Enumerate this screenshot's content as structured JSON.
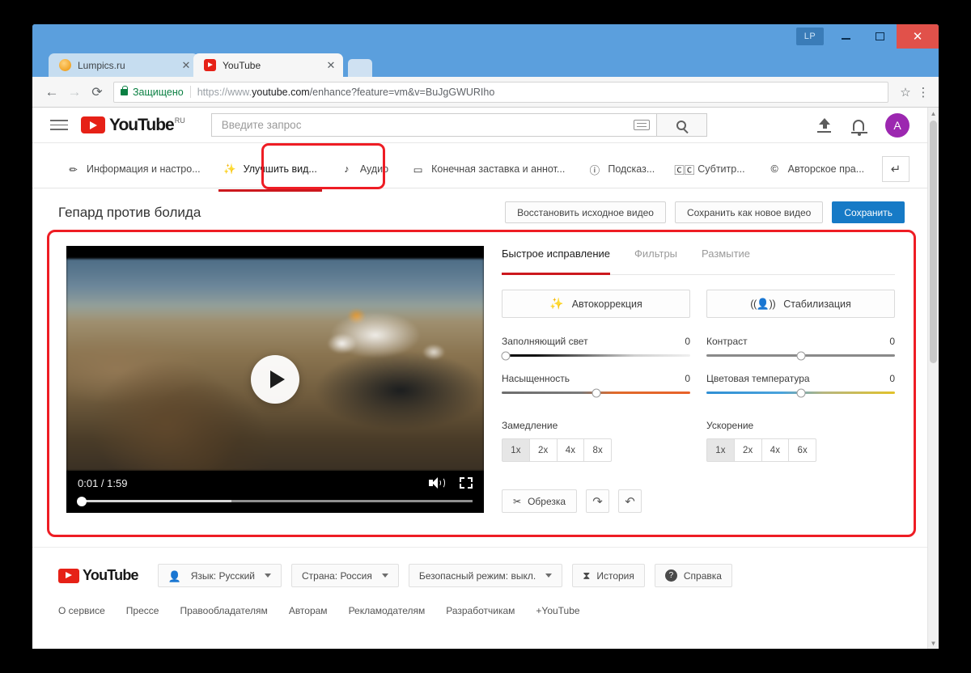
{
  "window": {
    "lp_badge": "LP",
    "minimize": "–",
    "maximize": "□",
    "close": "✕"
  },
  "browser": {
    "tabs": [
      {
        "title": "Lumpics.ru",
        "favicon": "lumpics-favicon",
        "active": false,
        "close": "✕"
      },
      {
        "title": "YouTube",
        "favicon": "youtube-favicon",
        "active": true,
        "close": "✕"
      }
    ],
    "new_tab": "+",
    "back": "←",
    "forward": "→",
    "reload": "⟳",
    "secure_label": "Защищено",
    "url_scheme": "https://www.",
    "url_host": "youtube.com",
    "url_path": "/enhance?feature=vm&v=BuJgGWURIho",
    "bookmark": "☆",
    "menu": "⋮"
  },
  "yt_header": {
    "menu_label": "Меню",
    "logo_text": "YouTube",
    "logo_sup": "RU",
    "search_placeholder": "Введите запрос",
    "search_value": "",
    "keyboard_icon": "keyboard-icon",
    "search_button": "search-icon",
    "upload_icon": "upload-icon",
    "notifications_icon": "bell-icon",
    "avatar_letter": "A"
  },
  "editor_nav": {
    "items": [
      {
        "label": "Информация и настро...",
        "icon": "pencil-icon",
        "active": false
      },
      {
        "label": "Улучшить вид...",
        "icon": "magic-wand-icon",
        "active": true
      },
      {
        "label": "Аудио",
        "icon": "music-note-icon",
        "active": false
      },
      {
        "label": "Конечная заставка и аннот...",
        "icon": "endscreen-icon",
        "active": false
      },
      {
        "label": "Подсказ...",
        "icon": "info-icon",
        "active": false
      },
      {
        "label": "Субтитр...",
        "icon": "cc-icon",
        "active": false
      },
      {
        "label": "Авторское пра...",
        "icon": "copyright-icon",
        "active": false
      }
    ],
    "back_button": "↵"
  },
  "title_row": {
    "video_title": "Гепард против болида",
    "restore_button": "Восстановить исходное видео",
    "save_as_new_button": "Сохранить как новое видео",
    "save_button": "Сохранить"
  },
  "player": {
    "play_button": "play-icon",
    "current_time": "0:01",
    "separator": "/",
    "duration": "1:59",
    "time_display": "0:01 / 1:59",
    "volume_icon": "volume-icon",
    "fullscreen_icon": "fullscreen-icon",
    "played_percent": 1,
    "buffered_percent": 39
  },
  "controls": {
    "tabs": [
      {
        "label": "Быстрое исправление",
        "active": true
      },
      {
        "label": "Фильтры",
        "active": false
      },
      {
        "label": "Размытие",
        "active": false
      }
    ],
    "actions": [
      {
        "label": "Автокоррекция",
        "icon": "magic-wand-icon"
      },
      {
        "label": "Стабилизация",
        "icon": "stabilize-icon"
      }
    ],
    "sliders": [
      {
        "label": "Заполняющий свет",
        "value": "0",
        "knob_percent": 2,
        "track": "fill"
      },
      {
        "label": "Контраст",
        "value": "0",
        "knob_percent": 50,
        "track": "contrast"
      },
      {
        "label": "Насыщенность",
        "value": "0",
        "knob_percent": 50,
        "track": "sat"
      },
      {
        "label": "Цветовая температура",
        "value": "0",
        "knob_percent": 50,
        "track": "temp"
      }
    ],
    "slowdown": {
      "label": "Замедление",
      "options": [
        "1x",
        "2x",
        "4x",
        "8x"
      ],
      "selected": "1x"
    },
    "speedup": {
      "label": "Ускорение",
      "options": [
        "1x",
        "2x",
        "4x",
        "6x"
      ],
      "selected": "1x"
    },
    "tools": {
      "trim_label": "Обрезка",
      "trim_icon": "scissors-icon",
      "rotate_right_icon": "↷",
      "rotate_left_icon": "↶"
    }
  },
  "footer": {
    "logo_text": "YouTube",
    "language_button": "Язык: Русский",
    "country_button": "Страна: Россия",
    "safe_mode_button": "Безопасный режим: выкл.",
    "history_button": "История",
    "help_button": "Справка",
    "links": [
      "О сервисе",
      "Прессе",
      "Правообладателям",
      "Авторам",
      "Рекламодателям",
      "Разработчикам",
      "+YouTube"
    ]
  },
  "scrollbar": {
    "up": "▲",
    "down": "▼"
  }
}
